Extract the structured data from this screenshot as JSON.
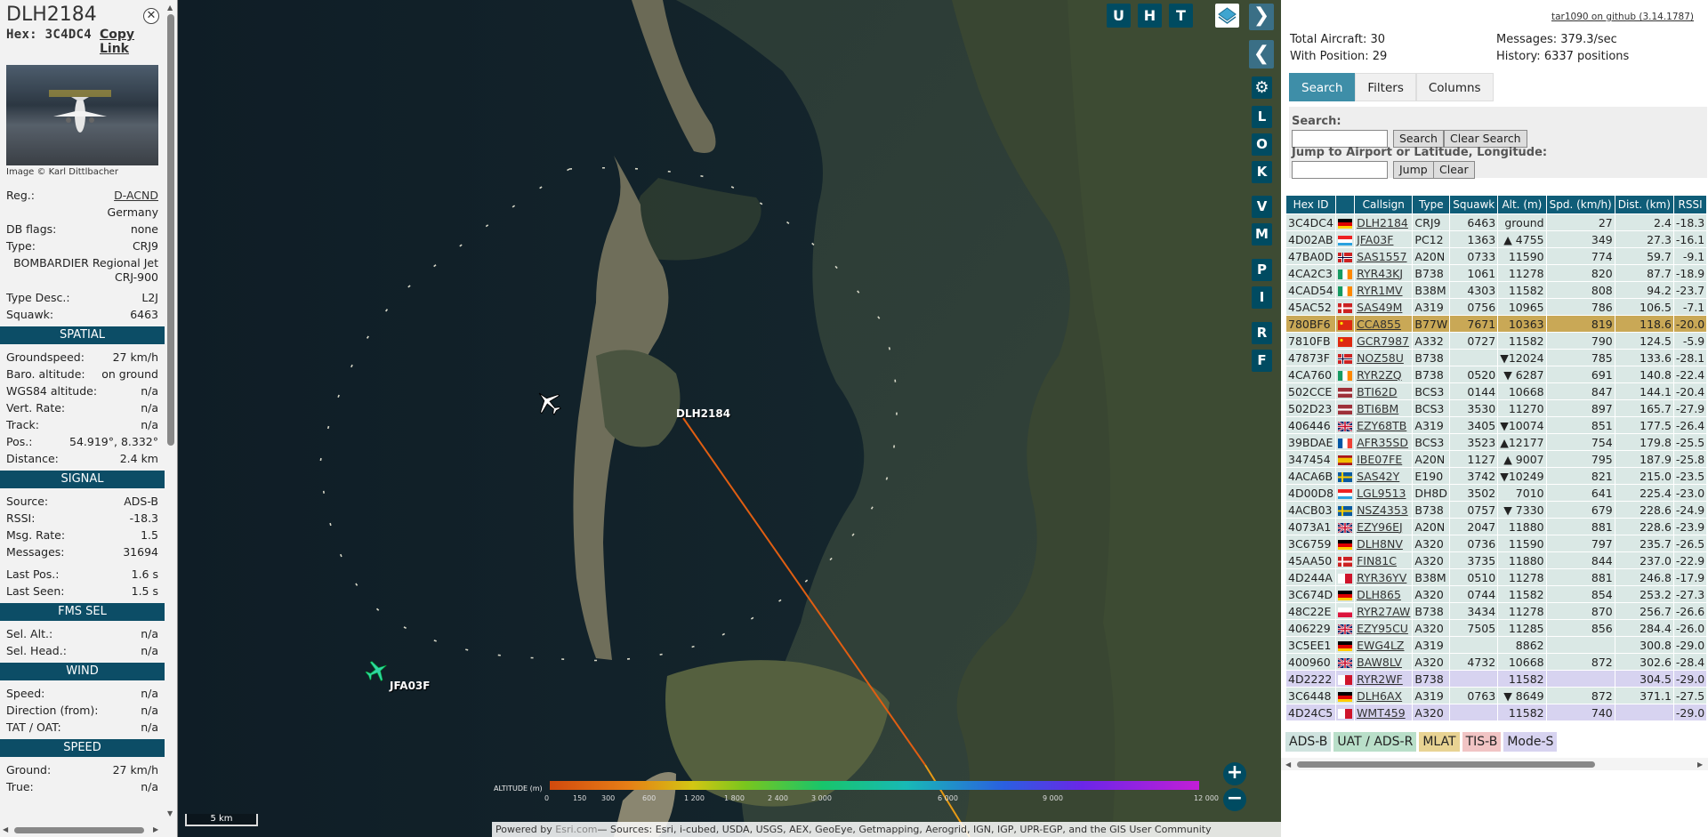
{
  "info": {
    "callsign": "DLH2184",
    "hex_label": "Hex: 3C4DC4",
    "copy_link": "Copy Link",
    "photo_credit": "Image © Karl Dittlbacher",
    "registration_label": "Reg.:",
    "registration": "D-ACND",
    "country": "Germany",
    "db_flags_label": "DB flags:",
    "db_flags": "none",
    "type_label": "Type:",
    "type": "CRJ9",
    "type_full": "BOMBARDIER Regional Jet CRJ-900",
    "type_desc_label": "Type Desc.:",
    "type_desc": "L2J",
    "squawk_label": "Squawk:",
    "squawk": "6463",
    "spatial_header": "SPATIAL",
    "groundspeed_label": "Groundspeed:",
    "groundspeed": "27 km/h",
    "baro_label": "Baro. altitude:",
    "baro": "on ground",
    "wgs_label": "WGS84 altitude:",
    "wgs": "n/a",
    "vert_label": "Vert. Rate:",
    "vert": "n/a",
    "track_label": "Track:",
    "track": "n/a",
    "pos_label": "Pos.:",
    "pos": "54.919°, 8.332°",
    "distance_label": "Distance:",
    "distance": "2.4 km",
    "signal_header": "SIGNAL",
    "source_label": "Source:",
    "source": "ADS-B",
    "rssi_label": "RSSI:",
    "rssi": "-18.3",
    "msgrate_label": "Msg. Rate:",
    "msgrate": "1.5",
    "messages_label": "Messages:",
    "messages": "31694",
    "lastpos_label": "Last Pos.:",
    "lastpos": "1.6 s",
    "lastseen_label": "Last Seen:",
    "lastseen": "1.5 s",
    "fms_header": "FMS SEL",
    "selalt_label": "Sel. Alt.:",
    "selalt": "n/a",
    "selhead_label": "Sel. Head.:",
    "selhead": "n/a",
    "wind_header": "WIND",
    "speed_label": "Speed:",
    "speed": "n/a",
    "direction_label": "Direction (from):",
    "direction": "n/a",
    "tat_label": "TAT / OAT:",
    "tat": "n/a",
    "speed_header": "SPEED",
    "ground_label": "Ground:",
    "ground": "27 km/h",
    "true_label": "True:",
    "true": "n/a"
  },
  "map": {
    "buttons_top": [
      "U",
      "H",
      "T"
    ],
    "buttons_side": [
      "L",
      "O",
      "K",
      "V",
      "M",
      "P",
      "I",
      "R",
      "F"
    ],
    "aircraft": [
      {
        "label": "DLH2184",
        "selected": true
      },
      {
        "label": "JFA03F",
        "selected": false
      }
    ],
    "altitude_legend_title": "ALTITUDE (m)",
    "altitude_ticks": [
      "0",
      "150",
      "300",
      "600",
      "1 200",
      "1 800",
      "2 400",
      "3 000",
      "6 000",
      "9 000",
      "12 000"
    ],
    "scale": "5 km",
    "attribution_prefix": "Powered by ",
    "attribution_link": "Esri.com",
    "attribution_rest": "— Sources: Esri, i-cubed, USDA, USGS, AEX, GeoEye, Getmapping, Aerogrid, IGN, IGP, UPR-EGP, and the GIS User Community",
    "zoom_in": "+",
    "zoom_out": "−"
  },
  "side": {
    "github_link": "tar1090 on github (3.14.1787)",
    "total_aircraft": "Total Aircraft: 30",
    "with_position": "With Position: 29",
    "messages": "Messages: 379.3/sec",
    "history": "History: 6337 positions",
    "tabs": [
      "Search",
      "Filters",
      "Columns"
    ],
    "search_label": "Search:",
    "search_button": "Search",
    "clear_search_button": "Clear Search",
    "jump_label": "Jump to Airport or Latitude, Longitude:",
    "jump_button": "Jump",
    "clear_button": "Clear",
    "columns": [
      "Hex ID",
      "",
      "Callsign",
      "Type",
      "Squawk",
      "Alt. (m)",
      "Spd. (km/h)",
      "Dist. (km)",
      "RSSI"
    ],
    "rows": [
      {
        "hex": "3C4DC4",
        "flag": "de",
        "callsign": "DLH2184",
        "type": "CRJ9",
        "squawk": "6463",
        "alt": "ground",
        "spd": "27",
        "dist": "2.4",
        "rssi": "-18.3",
        "cls": "adsb"
      },
      {
        "hex": "4D02AB",
        "flag": "lu",
        "callsign": "JFA03F",
        "type": "PC12",
        "squawk": "1363",
        "alt": "▲ 4755",
        "spd": "349",
        "dist": "27.3",
        "rssi": "-16.1",
        "cls": "adsb"
      },
      {
        "hex": "47BA0D",
        "flag": "no",
        "callsign": "SAS1557",
        "type": "A20N",
        "squawk": "0733",
        "alt": "11590",
        "spd": "774",
        "dist": "59.7",
        "rssi": "-9.1",
        "cls": "adsb"
      },
      {
        "hex": "4CA2C3",
        "flag": "ie",
        "callsign": "RYR43KJ",
        "type": "B738",
        "squawk": "1061",
        "alt": "11278",
        "spd": "820",
        "dist": "87.7",
        "rssi": "-18.9",
        "cls": "adsb"
      },
      {
        "hex": "4CAD54",
        "flag": "ie",
        "callsign": "RYR1MV",
        "type": "B38M",
        "squawk": "4303",
        "alt": "11582",
        "spd": "808",
        "dist": "94.2",
        "rssi": "-23.7",
        "cls": "adsb"
      },
      {
        "hex": "45AC52",
        "flag": "dk",
        "callsign": "SAS49M",
        "type": "A319",
        "squawk": "0756",
        "alt": "10965",
        "spd": "786",
        "dist": "106.5",
        "rssi": "-7.1",
        "cls": "adsb"
      },
      {
        "hex": "780BF6",
        "flag": "cn",
        "callsign": "CCA855",
        "type": "B77W",
        "squawk": "7671",
        "alt": "10363",
        "spd": "819",
        "dist": "118.6",
        "rssi": "-20.0",
        "cls": "sel"
      },
      {
        "hex": "7810FB",
        "flag": "cn",
        "callsign": "GCR7987",
        "type": "A332",
        "squawk": "0727",
        "alt": "11582",
        "spd": "790",
        "dist": "124.5",
        "rssi": "-5.9",
        "cls": "adsb"
      },
      {
        "hex": "47873F",
        "flag": "no",
        "callsign": "NOZ58U",
        "type": "B738",
        "squawk": "",
        "alt": "▼12024",
        "spd": "785",
        "dist": "133.6",
        "rssi": "-28.1",
        "cls": "adsb"
      },
      {
        "hex": "4CA760",
        "flag": "ie",
        "callsign": "RYR2ZQ",
        "type": "B738",
        "squawk": "0520",
        "alt": "▼ 6287",
        "spd": "691",
        "dist": "140.8",
        "rssi": "-22.4",
        "cls": "adsb"
      },
      {
        "hex": "502CCE",
        "flag": "lv",
        "callsign": "BTI62D",
        "type": "BCS3",
        "squawk": "0144",
        "alt": "10668",
        "spd": "847",
        "dist": "144.1",
        "rssi": "-20.4",
        "cls": "adsb"
      },
      {
        "hex": "502D23",
        "flag": "lv",
        "callsign": "BTI6BM",
        "type": "BCS3",
        "squawk": "3530",
        "alt": "11270",
        "spd": "897",
        "dist": "165.7",
        "rssi": "-27.9",
        "cls": "adsb"
      },
      {
        "hex": "406446",
        "flag": "gb",
        "callsign": "EZY68TB",
        "type": "A319",
        "squawk": "3405",
        "alt": "▼10074",
        "spd": "851",
        "dist": "177.5",
        "rssi": "-26.4",
        "cls": "adsb"
      },
      {
        "hex": "39BDAE",
        "flag": "fr",
        "callsign": "AFR35SD",
        "type": "BCS3",
        "squawk": "3523",
        "alt": "▲12177",
        "spd": "754",
        "dist": "179.8",
        "rssi": "-25.5",
        "cls": "adsb"
      },
      {
        "hex": "347454",
        "flag": "es",
        "callsign": "IBE07FE",
        "type": "A20N",
        "squawk": "1127",
        "alt": "▲ 9007",
        "spd": "795",
        "dist": "187.9",
        "rssi": "-25.8",
        "cls": "adsb"
      },
      {
        "hex": "4ACA6B",
        "flag": "se",
        "callsign": "SAS42Y",
        "type": "E190",
        "squawk": "3742",
        "alt": "▼10249",
        "spd": "821",
        "dist": "215.0",
        "rssi": "-23.5",
        "cls": "adsb"
      },
      {
        "hex": "4D00D8",
        "flag": "lu",
        "callsign": "LGL9513",
        "type": "DH8D",
        "squawk": "3502",
        "alt": "7010",
        "spd": "641",
        "dist": "225.4",
        "rssi": "-23.0",
        "cls": "adsb"
      },
      {
        "hex": "4ACB03",
        "flag": "se",
        "callsign": "NSZ4353",
        "type": "B738",
        "squawk": "0757",
        "alt": "▼ 7330",
        "spd": "679",
        "dist": "228.6",
        "rssi": "-24.9",
        "cls": "adsb"
      },
      {
        "hex": "4073A1",
        "flag": "gb",
        "callsign": "EZY96EJ",
        "type": "A20N",
        "squawk": "2047",
        "alt": "11880",
        "spd": "881",
        "dist": "228.6",
        "rssi": "-23.9",
        "cls": "adsb"
      },
      {
        "hex": "3C6759",
        "flag": "de",
        "callsign": "DLH8NV",
        "type": "A320",
        "squawk": "0736",
        "alt": "11590",
        "spd": "797",
        "dist": "235.7",
        "rssi": "-26.5",
        "cls": "adsb"
      },
      {
        "hex": "45AA50",
        "flag": "dk",
        "callsign": "FIN81C",
        "type": "A320",
        "squawk": "3735",
        "alt": "11880",
        "spd": "844",
        "dist": "237.0",
        "rssi": "-22.9",
        "cls": "adsb"
      },
      {
        "hex": "4D244A",
        "flag": "mt",
        "callsign": "RYR36YV",
        "type": "B38M",
        "squawk": "0510",
        "alt": "11278",
        "spd": "881",
        "dist": "246.8",
        "rssi": "-17.9",
        "cls": "adsb"
      },
      {
        "hex": "3C674D",
        "flag": "de",
        "callsign": "DLH865",
        "type": "A320",
        "squawk": "0744",
        "alt": "11582",
        "spd": "854",
        "dist": "253.2",
        "rssi": "-27.3",
        "cls": "adsb"
      },
      {
        "hex": "48C22E",
        "flag": "pl",
        "callsign": "RYR27AW",
        "type": "B738",
        "squawk": "3434",
        "alt": "11278",
        "spd": "870",
        "dist": "256.7",
        "rssi": "-26.6",
        "cls": "adsb"
      },
      {
        "hex": "406229",
        "flag": "gb",
        "callsign": "EZY95CU",
        "type": "A320",
        "squawk": "7505",
        "alt": "11285",
        "spd": "856",
        "dist": "284.4",
        "rssi": "-26.0",
        "cls": "adsb"
      },
      {
        "hex": "3C5EE1",
        "flag": "de",
        "callsign": "EWG4LZ",
        "type": "A319",
        "squawk": "",
        "alt": "8862",
        "spd": "",
        "dist": "300.8",
        "rssi": "-29.0",
        "cls": "adsb"
      },
      {
        "hex": "400960",
        "flag": "gb",
        "callsign": "BAW8LV",
        "type": "A320",
        "squawk": "4732",
        "alt": "10668",
        "spd": "872",
        "dist": "302.6",
        "rssi": "-28.4",
        "cls": "adsb"
      },
      {
        "hex": "4D2222",
        "flag": "mt",
        "callsign": "RYR2WF",
        "type": "B738",
        "squawk": "",
        "alt": "11582",
        "spd": "",
        "dist": "304.5",
        "rssi": "-29.0",
        "cls": "mode"
      },
      {
        "hex": "3C6448",
        "flag": "de",
        "callsign": "DLH6AX",
        "type": "A319",
        "squawk": "0763",
        "alt": "▼ 8649",
        "spd": "872",
        "dist": "371.1",
        "rssi": "-27.5",
        "cls": "adsb"
      },
      {
        "hex": "4D24C5",
        "flag": "mt",
        "callsign": "WMT459",
        "type": "A320",
        "squawk": "",
        "alt": "11582",
        "spd": "740",
        "dist": "",
        "rssi": "-29.0",
        "cls": "mode"
      }
    ],
    "legend": [
      {
        "label": "ADS-B",
        "color": "#cfe3df"
      },
      {
        "label": "UAT / ADS-R",
        "color": "#b9dfc9"
      },
      {
        "label": "MLAT",
        "color": "#e8d393"
      },
      {
        "label": "TIS-B",
        "color": "#f1c4c4"
      },
      {
        "label": "Mode-S",
        "color": "#d7d3f0"
      }
    ]
  }
}
